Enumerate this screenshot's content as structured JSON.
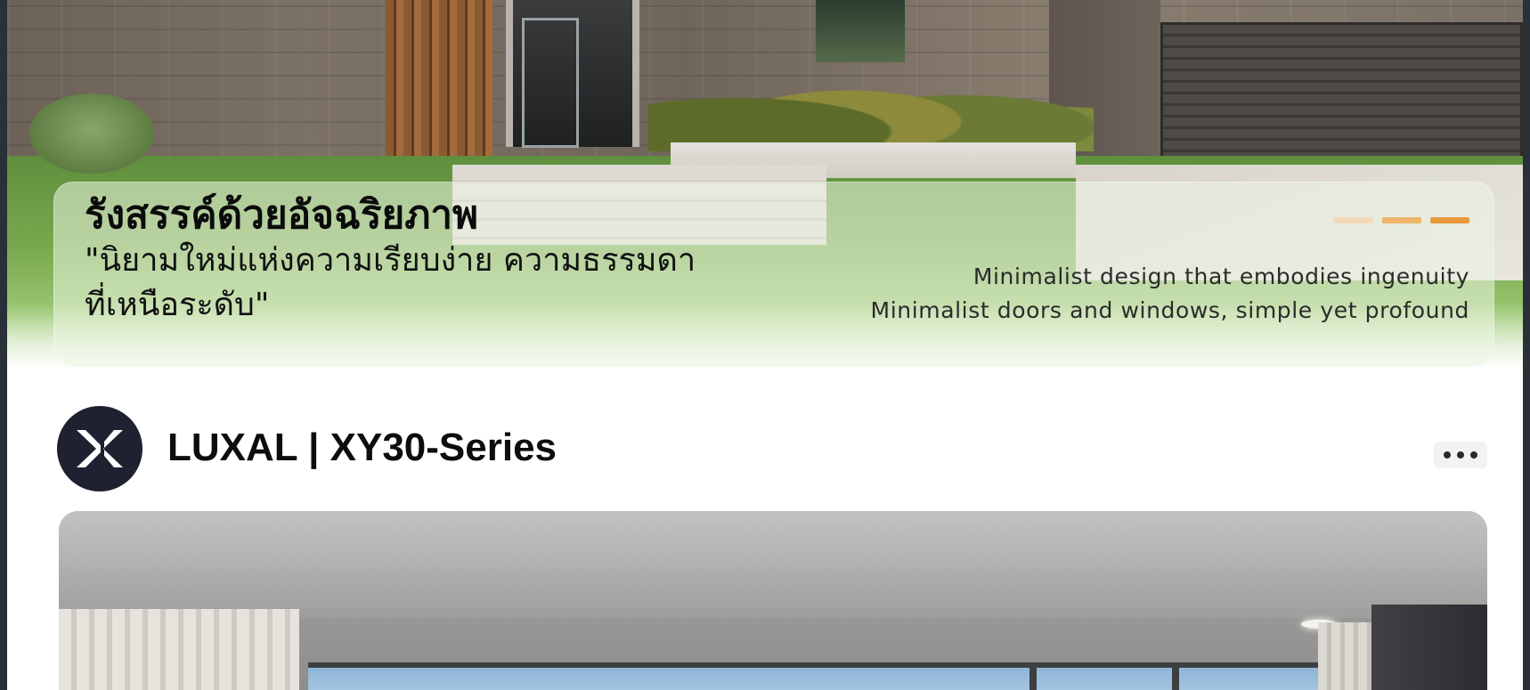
{
  "hero": {
    "title": "รังสรรค์ด้วยอัจฉริยภาพ",
    "quote": "\"นิยามใหม่แห่งความเรียบง่าย ความธรรมดาที่เหนือระดับ\"",
    "tagline_1": "Minimalist design that embodies ingenuity",
    "tagline_2": "Minimalist doors and windows, simple yet profound",
    "indicator_colors": [
      "#f2d9b8",
      "#eeb46a",
      "#e89a3c"
    ]
  },
  "profile": {
    "brand_name": "LUXAL | XY30-Series",
    "avatar_icon": "x-logo-icon",
    "more_icon": "more-horizontal-icon"
  },
  "colors": {
    "frame": "#2a3038",
    "avatar_bg": "#1d2130",
    "accent": "#e89a3c"
  }
}
